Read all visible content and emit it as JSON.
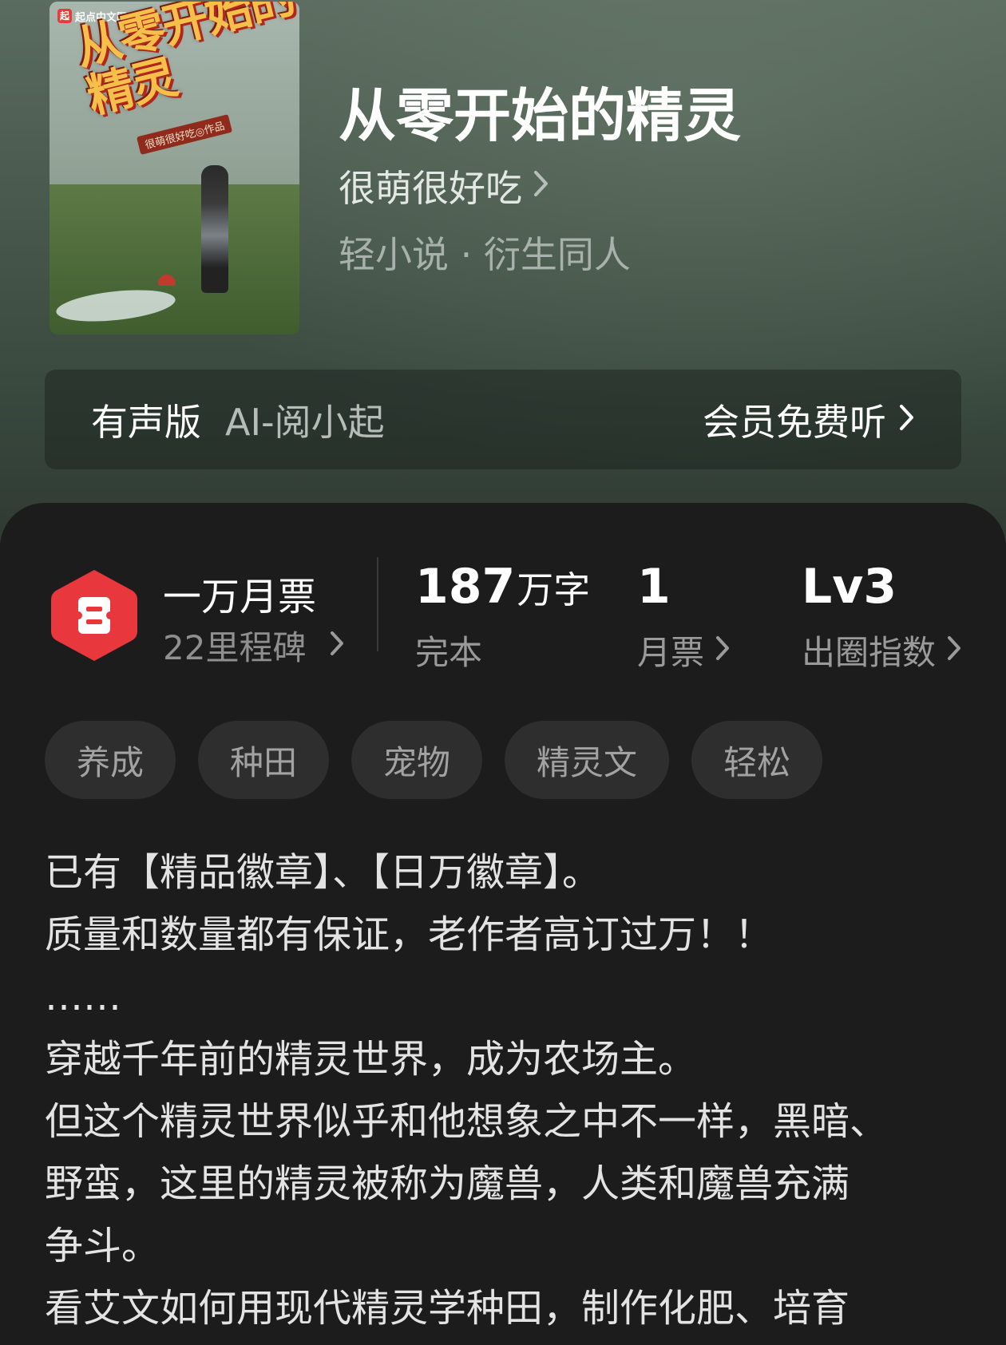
{
  "cover": {
    "publisher": "起点中文网",
    "publisher_mark": "起",
    "title": "从零开始的精灵",
    "author_credit": "很萌很好吃◎作品"
  },
  "book": {
    "title": "从零开始的精灵",
    "author": "很萌很好吃",
    "genre": "轻小说 · 衍生同人"
  },
  "audio": {
    "label": "有声版",
    "voice": "AI-阅小起",
    "action": "会员免费听"
  },
  "ticket_badge": {
    "title": "一万月票",
    "subtitle": "22里程碑"
  },
  "stats": [
    {
      "value": "187",
      "unit": "万字",
      "label": "完本"
    },
    {
      "value": "1",
      "unit": "",
      "label": "月票"
    },
    {
      "value": "Lv3",
      "unit": "",
      "label": "出圈指数"
    }
  ],
  "tags": [
    "养成",
    "种田",
    "宠物",
    "精灵文",
    "轻松"
  ],
  "synopsis": [
    "已有【精品徽章】、【日万徽章】。",
    "质量和数量都有保证，老作者高订过万！！",
    "……",
    "穿越千年前的精灵世界，成为农场主。",
    "但这个精灵世界似乎和他想象之中不一样，黑暗、",
    "野蛮，这里的精灵被称为魔兽，人类和魔兽充满",
    "争斗。",
    "看艾文如何用现代精灵学种田，制作化肥、培育"
  ],
  "colors": {
    "badge_red": "#e8383d",
    "hero_green": "#4a5a4f",
    "panel_bg": "#1c1c1c",
    "tag_bg": "#2e2e2e"
  }
}
